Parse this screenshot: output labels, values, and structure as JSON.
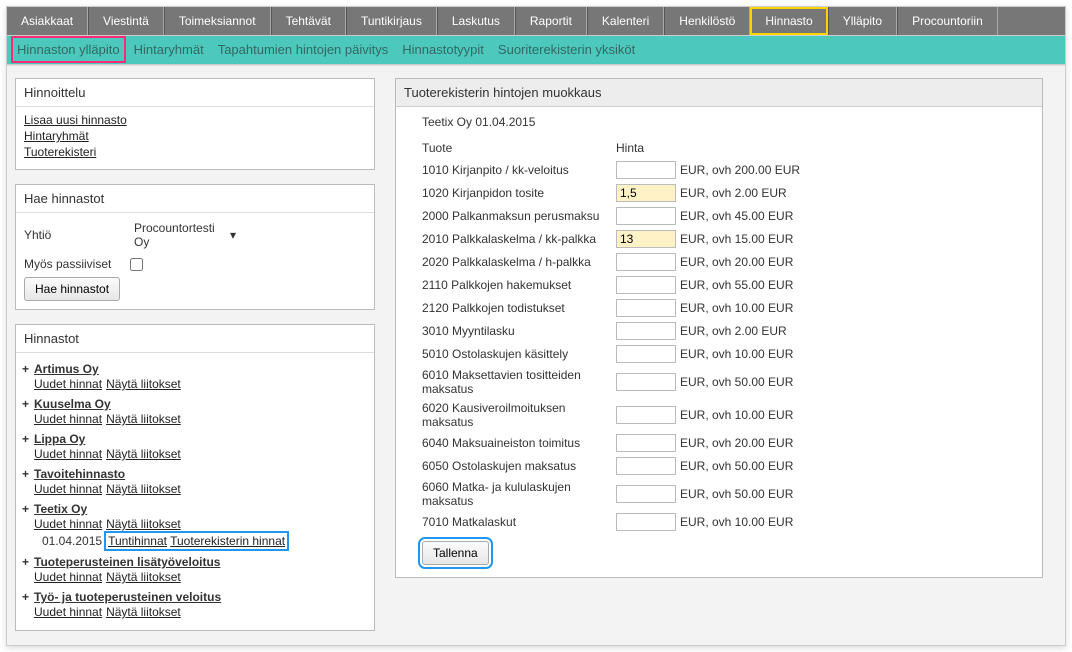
{
  "topnav": {
    "tabs": [
      "Asiakkaat",
      "Viestintä",
      "Toimeksiannot",
      "Tehtävät",
      "Tuntikirjaus",
      "Laskutus",
      "Raportit",
      "Kalenteri",
      "Henkilöstö",
      "Hinnasto",
      "Ylläpito",
      "Procountoriin"
    ],
    "active_index": 9
  },
  "subnav": {
    "items": [
      "Hinnaston ylläpito",
      "Hintaryhmät",
      "Tapahtumien hintojen päivitys",
      "Hinnastotyypit",
      "Suoriterekisterin yksiköt"
    ],
    "active_index": 0
  },
  "sidebar": {
    "hinnoittelu": {
      "title": "Hinnoittelu",
      "links": [
        "Lisaa uusi hinnasto",
        "Hintaryhmät",
        "Tuoterekisteri"
      ]
    },
    "hae": {
      "title": "Hae hinnastot",
      "yhtio_label": "Yhtiö",
      "yhtio_value": "Procountortesti Oy",
      "passiiviset_label": "Myös passiiviset",
      "button": "Hae hinnastot"
    },
    "hinnastot": {
      "title": "Hinnastot",
      "groups": [
        {
          "title": "Artimus Oy",
          "links": [
            "Uudet hinnat",
            "Näytä liitokset"
          ]
        },
        {
          "title": "Kuuselma Oy",
          "links": [
            "Uudet hinnat",
            "Näytä liitokset"
          ]
        },
        {
          "title": "Lippa Oy",
          "links": [
            "Uudet hinnat",
            "Näytä liitokset"
          ]
        },
        {
          "title": "Tavoitehinnasto",
          "links": [
            "Uudet hinnat",
            "Näytä liitokset"
          ]
        },
        {
          "title": "Teetix Oy",
          "links": [
            "Uudet hinnat",
            "Näytä liitokset"
          ],
          "subrow": {
            "date": "01.04.2015",
            "items": [
              "Tuntihinnat",
              "Tuoterekisterin hinnat"
            ]
          }
        },
        {
          "title": "Tuoteperusteinen lisätyöveloitus",
          "links": [
            "Uudet hinnat",
            "Näytä liitokset"
          ]
        },
        {
          "title": "Työ- ja tuoteperusteinen veloitus",
          "links": [
            "Uudet hinnat",
            "Näytä liitokset"
          ]
        }
      ]
    }
  },
  "main": {
    "title": "Tuoterekisterin hintojen muokkaus",
    "company_line": "Teetix Oy 01.04.2015",
    "headers": {
      "c1": "Tuote",
      "c2": "Hinta"
    },
    "rows": [
      {
        "label": "1010 Kirjanpito / kk-veloitus",
        "value": "",
        "after": "EUR, ovh 200.00 EUR"
      },
      {
        "label": "1020 Kirjanpidon tosite",
        "value": "1,5",
        "after": "EUR, ovh 2.00 EUR"
      },
      {
        "label": "2000 Palkanmaksun perusmaksu",
        "value": "",
        "after": "EUR, ovh 45.00 EUR"
      },
      {
        "label": "2010 Palkkalaskelma / kk-palkka",
        "value": "13",
        "after": "EUR, ovh 15.00 EUR"
      },
      {
        "label": "2020 Palkkalaskelma / h-palkka",
        "value": "",
        "after": "EUR, ovh 20.00 EUR"
      },
      {
        "label": "2110 Palkkojen hakemukset",
        "value": "",
        "after": "EUR, ovh 55.00 EUR"
      },
      {
        "label": "2120 Palkkojen todistukset",
        "value": "",
        "after": "EUR, ovh 10.00 EUR"
      },
      {
        "label": "3010 Myyntilasku",
        "value": "",
        "after": "EUR, ovh 2.00 EUR"
      },
      {
        "label": "5010 Ostolaskujen käsittely",
        "value": "",
        "after": "EUR, ovh 10.00 EUR"
      },
      {
        "label": "6010 Maksettavien tositteiden maksatus",
        "value": "",
        "after": "EUR, ovh 50.00 EUR"
      },
      {
        "label": "6020 Kausiveroilmoituksen maksatus",
        "value": "",
        "after": "EUR, ovh 10.00 EUR"
      },
      {
        "label": "6040 Maksuaineiston toimitus",
        "value": "",
        "after": "EUR, ovh 20.00 EUR"
      },
      {
        "label": "6050 Ostolaskujen maksatus",
        "value": "",
        "after": "EUR, ovh 50.00 EUR"
      },
      {
        "label": "6060 Matka- ja kululaskujen maksatus",
        "value": "",
        "after": "EUR, ovh 50.00 EUR"
      },
      {
        "label": "7010 Matkalaskut",
        "value": "",
        "after": "EUR, ovh 10.00 EUR"
      }
    ],
    "save": "Tallenna"
  }
}
